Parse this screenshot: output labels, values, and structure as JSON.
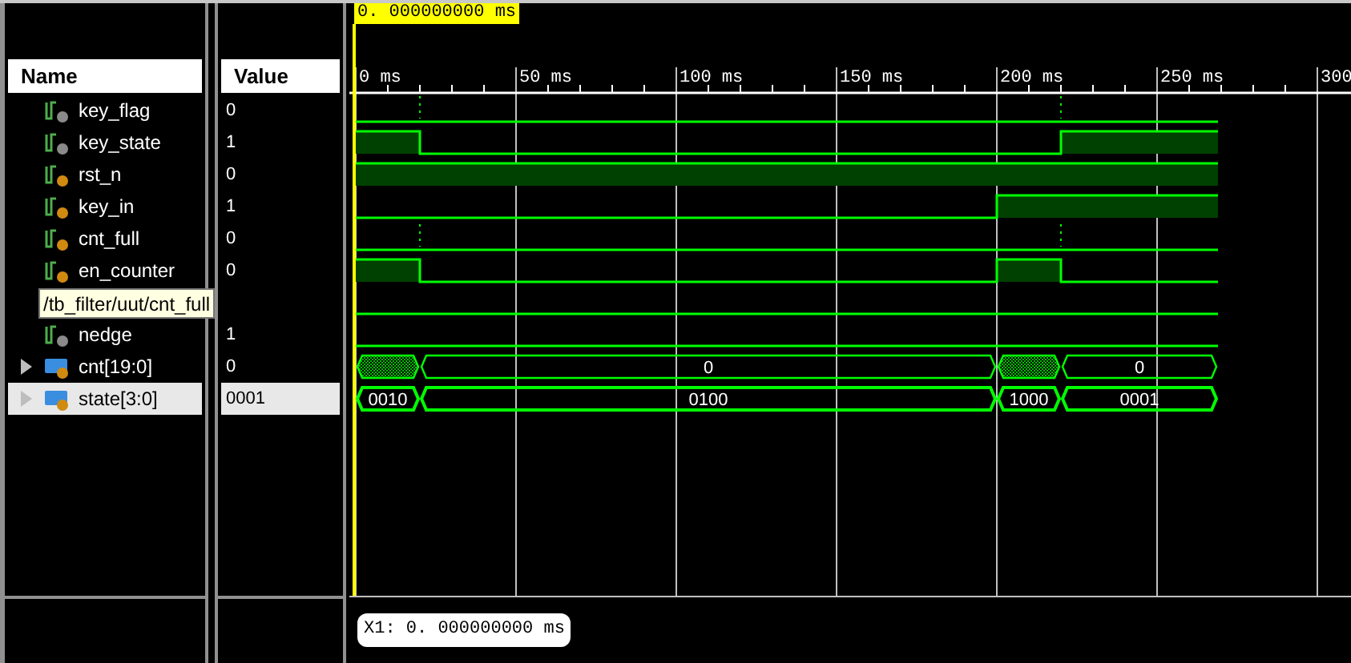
{
  "cursor_time": "0. 000000000 ms",
  "headers": {
    "name": "Name",
    "value": "Value"
  },
  "timeline": {
    "ticks": [
      "0 ms",
      "50 ms",
      "100 ms",
      "150 ms",
      "200 ms",
      "250 ms",
      "300"
    ]
  },
  "signals": [
    {
      "name": "key_flag",
      "value": "0",
      "kind": "bit",
      "port": false,
      "selected": false
    },
    {
      "name": "key_state",
      "value": "1",
      "kind": "bit",
      "port": false,
      "selected": false
    },
    {
      "name": "rst_n",
      "value": "0",
      "kind": "bit",
      "port": true,
      "selected": false
    },
    {
      "name": "key_in",
      "value": "1",
      "kind": "bit",
      "port": true,
      "selected": false
    },
    {
      "name": "cnt_full",
      "value": "0",
      "kind": "bit",
      "port": true,
      "selected": false
    },
    {
      "name": "en_counter",
      "value": "0",
      "kind": "bit",
      "port": true,
      "selected": false
    },
    {
      "kind": "bit",
      "selected": false
    },
    {
      "name": "nedge",
      "value": "1",
      "kind": "bit",
      "port": false,
      "selected": false
    },
    {
      "name": "cnt[19:0]",
      "value": "0",
      "kind": "bus",
      "port": true,
      "expanded": false,
      "selected": false,
      "segments": [
        {
          "kind": "unknown"
        },
        {
          "kind": "value",
          "label": "0"
        },
        {
          "kind": "unknown"
        },
        {
          "kind": "value",
          "label": "0"
        }
      ]
    },
    {
      "name": "state[3:0]",
      "value": "0001",
      "kind": "bus",
      "port": true,
      "expanded": false,
      "selected": true,
      "segments": [
        {
          "kind": "value",
          "label": "0010"
        },
        {
          "kind": "value",
          "label": "0100"
        },
        {
          "kind": "value",
          "label": "1000"
        },
        {
          "kind": "value",
          "label": "0001"
        }
      ]
    }
  ],
  "tooltip": "/tb_filter/uut/cnt_full",
  "marker": "X1: 0. 000000000 ms"
}
